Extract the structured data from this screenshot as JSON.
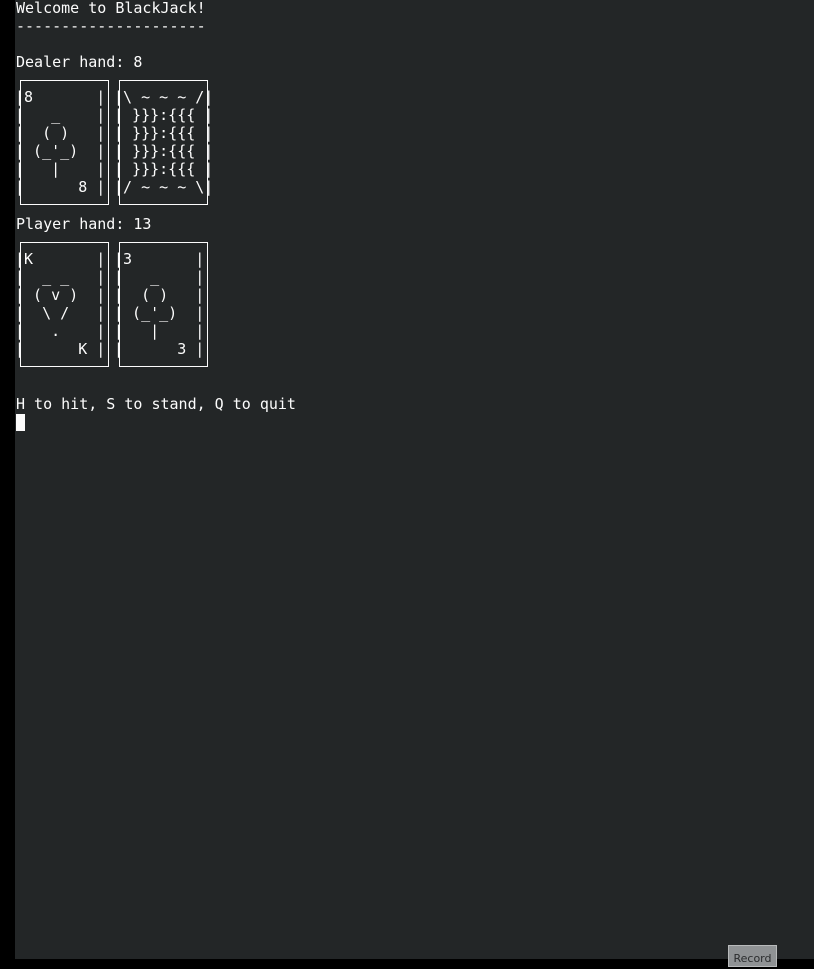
{
  "terminal": {
    "welcome": "Welcome to BlackJack!",
    "separator": "---------------------",
    "dealer_hand_label": "Dealer hand: 8",
    "player_hand_label": "Player hand: 13",
    "prompt": "H to hit, S to stand, Q to quit"
  },
  "dealer": {
    "cards": [
      {
        "rank": "8",
        "suit": "clubs",
        "face_up": true,
        "art": "|8       |\n|   _    |\n|  ( )   |\n| (_'_)  |\n|   |    |\n|      8 |"
      },
      {
        "rank": "",
        "suit": "",
        "face_up": false,
        "art": "|\\ ~ ~ ~ /|\n| }}}:{{{ |\n| }}}:{{{ |\n| }}}:{{{ |\n| }}}:{{{ |\n|/ ~ ~ ~ \\|"
      }
    ]
  },
  "player": {
    "cards": [
      {
        "rank": "K",
        "suit": "hearts",
        "face_up": true,
        "art": "|K       |\n|  _ _   |\n| ( v )  |\n|  \\ /   |\n|   .    |\n|      K |"
      },
      {
        "rank": "3",
        "suit": "clubs",
        "face_up": true,
        "art": "|3       |\n|   _    |\n|  ( )   |\n| (_'_)  |\n|   |    |\n|      3 |"
      }
    ]
  },
  "record_button": {
    "label": "Record"
  }
}
